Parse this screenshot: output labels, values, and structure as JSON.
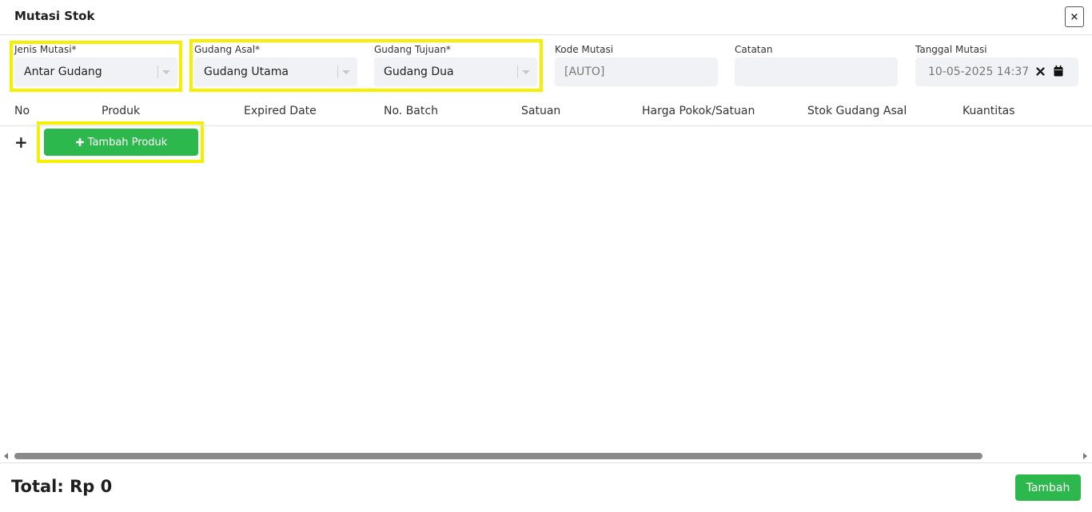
{
  "header": {
    "title": "Mutasi Stok",
    "close_label": "×"
  },
  "form": {
    "jenis_mutasi": {
      "label": "Jenis Mutasi*",
      "value": "Antar Gudang"
    },
    "gudang_asal": {
      "label": "Gudang Asal*",
      "value": "Gudang Utama"
    },
    "gudang_tujuan": {
      "label": "Gudang Tujuan*",
      "value": "Gudang Dua"
    },
    "kode_mutasi": {
      "label": "Kode Mutasi",
      "placeholder": "[AUTO]"
    },
    "catatan": {
      "label": "Catatan",
      "value": ""
    },
    "tanggal_mutasi": {
      "label": "Tanggal Mutasi",
      "value": "10-05-2025 14:37"
    }
  },
  "table": {
    "columns": [
      "No",
      "Produk",
      "Expired Date",
      "No. Batch",
      "Satuan",
      "Harga Pokok/Satuan",
      "Stok Gudang Asal",
      "Kuantitas"
    ],
    "add_row_icon": "+",
    "add_product_label": "Tambah Produk"
  },
  "footer": {
    "total": "Total: Rp 0",
    "submit_label": "Tambah"
  },
  "colors": {
    "highlight": "#f4f000",
    "accent": "#2db84d"
  }
}
